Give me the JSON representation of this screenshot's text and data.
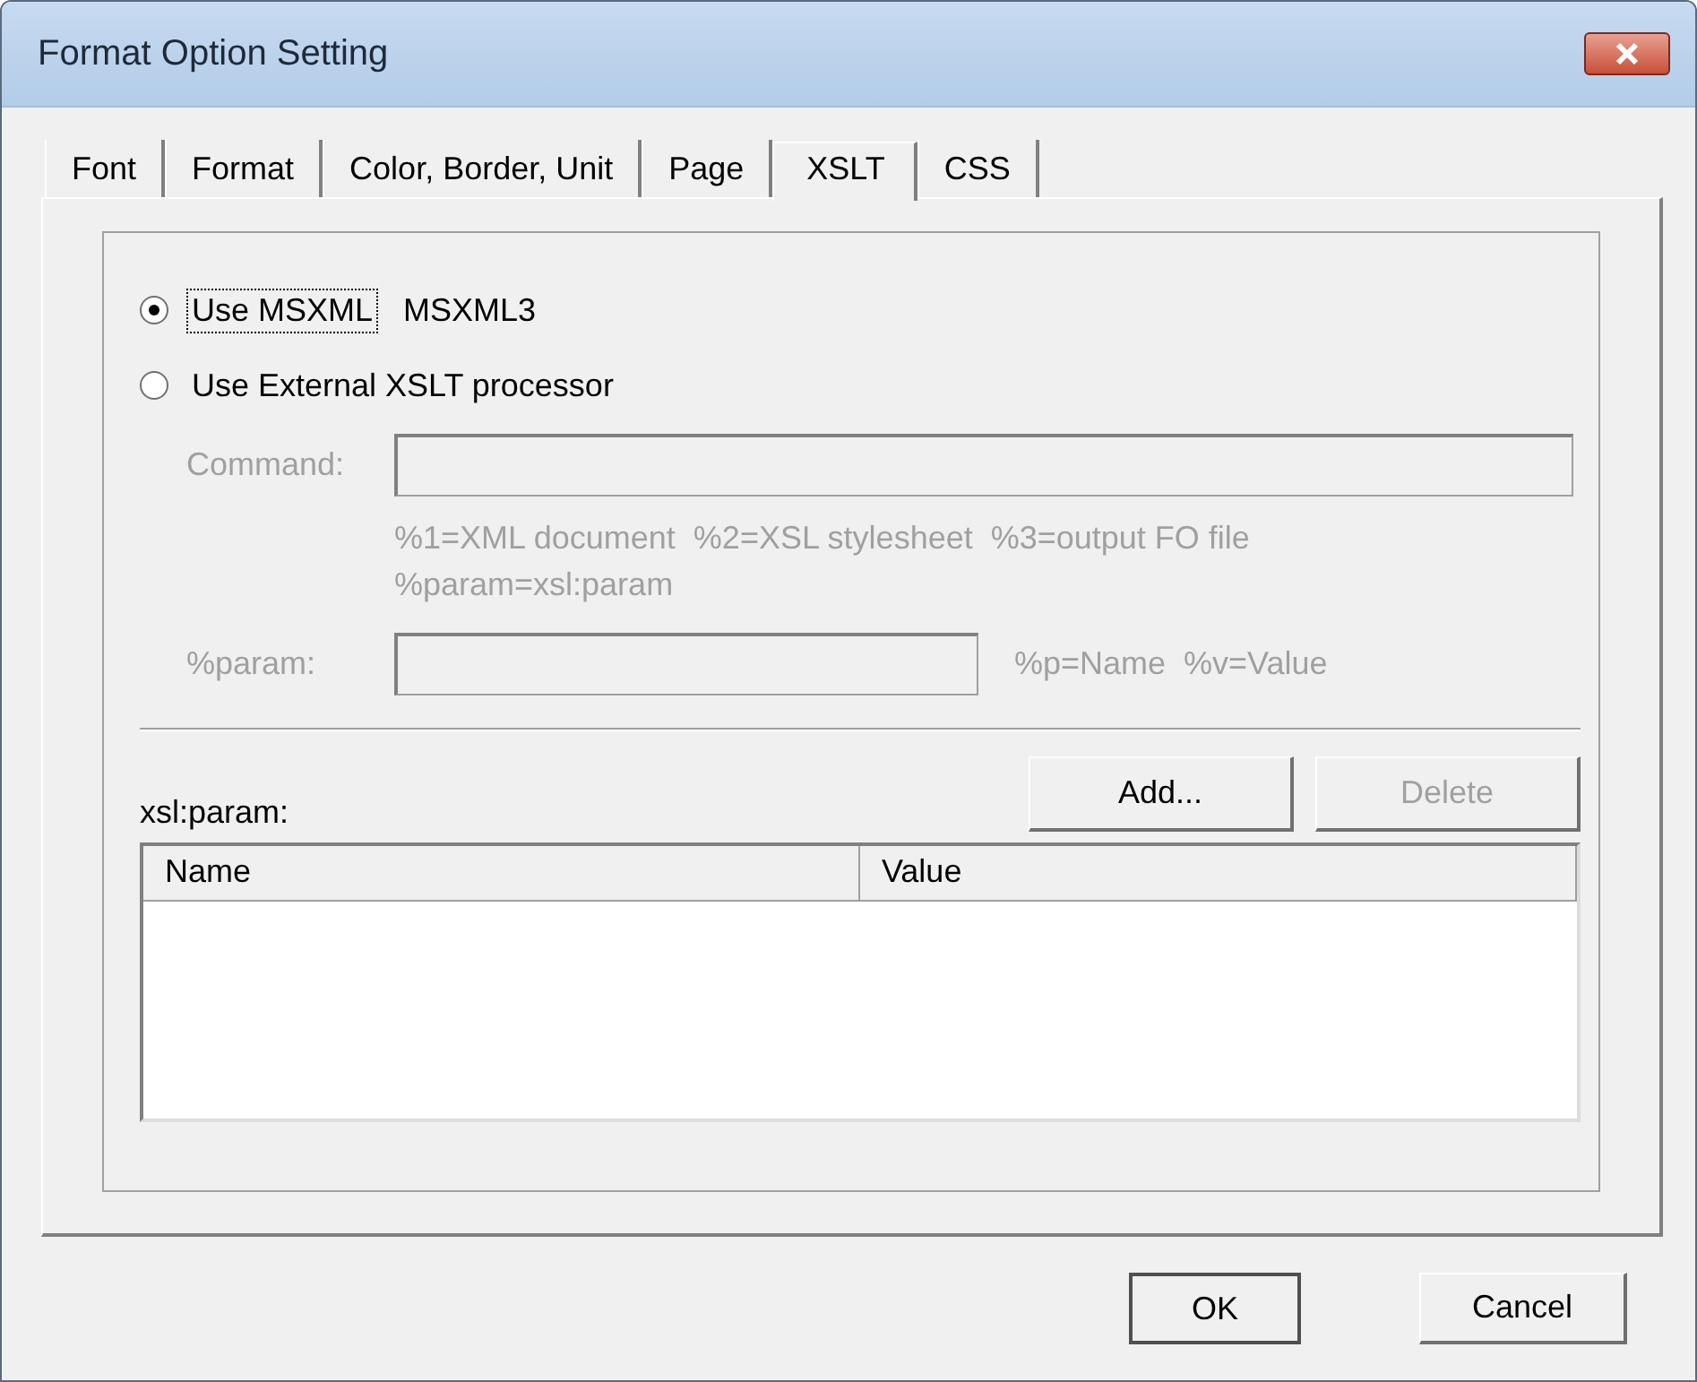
{
  "window": {
    "title": "Format Option Setting"
  },
  "tabs": [
    {
      "label": "Font",
      "selected": false
    },
    {
      "label": "Format",
      "selected": false
    },
    {
      "label": "Color, Border, Unit",
      "selected": false
    },
    {
      "label": "Page",
      "selected": false
    },
    {
      "label": "XSLT",
      "selected": true
    },
    {
      "label": "CSS",
      "selected": false
    }
  ],
  "processor": {
    "options": [
      {
        "label": "Use MSXML",
        "selected": true,
        "focused": true
      },
      {
        "label": "Use External XSLT processor",
        "selected": false,
        "focused": false
      }
    ],
    "msxml_version": "MSXML3"
  },
  "command": {
    "label": "Command:",
    "disabled": true
  },
  "command_help": [
    "%1=XML document  %2=XSL stylesheet  %3=output FO file",
    "%param=xsl:param"
  ],
  "param": {
    "label": "%param:",
    "disabled": true,
    "hint": "%p=Name  %v=Value"
  },
  "xsl_param": {
    "label": "xsl:param:",
    "buttons": [
      {
        "label": "Add...",
        "disabled": false
      },
      {
        "label": "Delete",
        "disabled": true
      }
    ],
    "columns": [
      "Name",
      "Value"
    ]
  },
  "buttons": [
    {
      "label": "OK",
      "default": true
    },
    {
      "label": "Cancel",
      "default": false
    }
  ]
}
